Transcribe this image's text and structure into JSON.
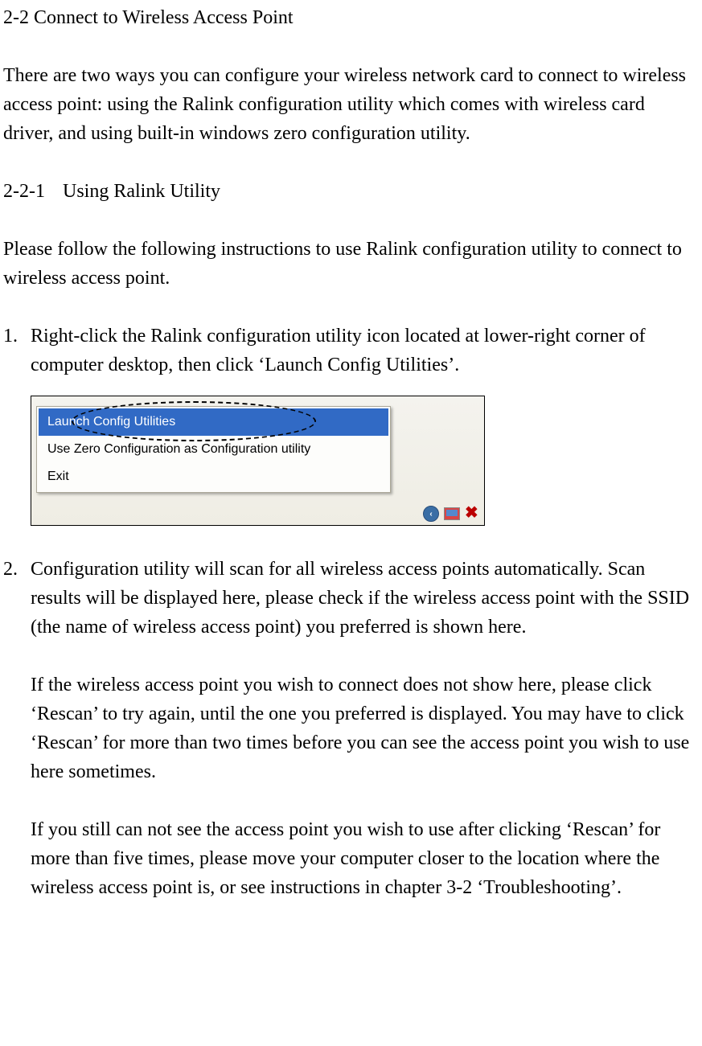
{
  "section_heading": "2-2 Connect to Wireless Access Point",
  "intro_para": "There are two ways you can configure your wireless network card to connect to wireless access point: using the Ralink configuration utility which comes with wireless card driver, and using built-in windows zero configuration utility.",
  "subsection": {
    "number": "2-2-1",
    "title": "Using Ralink Utility"
  },
  "subsection_intro": "Please follow the following instructions to use Ralink configuration utility to connect to wireless access point.",
  "steps": [
    {
      "num": "1.",
      "text": "Right-click the Ralink configuration utility icon located at lower-right corner of computer desktop, then click ‘Launch Config Utilities’."
    },
    {
      "num": "2.",
      "paras": [
        "Configuration utility will scan for all wireless access points automatically. Scan results will be displayed here, please check if the wireless access point with the SSID (the name of wireless access point) you preferred is shown here.",
        "If the wireless access point you wish to connect does not show here, please click ‘Rescan’ to try again, until the one you preferred is displayed. You may have to click ‘Rescan’ for more than two times before you can see the access point you wish to use here sometimes.",
        "If you still can not see the access point you wish to use after clicking ‘Rescan’ for more than five times, please move your computer closer to the location where the wireless access point is, or see instructions in chapter 3-2 ‘Troubleshooting’."
      ]
    }
  ],
  "context_menu": {
    "items": [
      "Launch Config Utilities",
      "Use Zero Configuration as Configuration utility",
      "Exit"
    ]
  }
}
